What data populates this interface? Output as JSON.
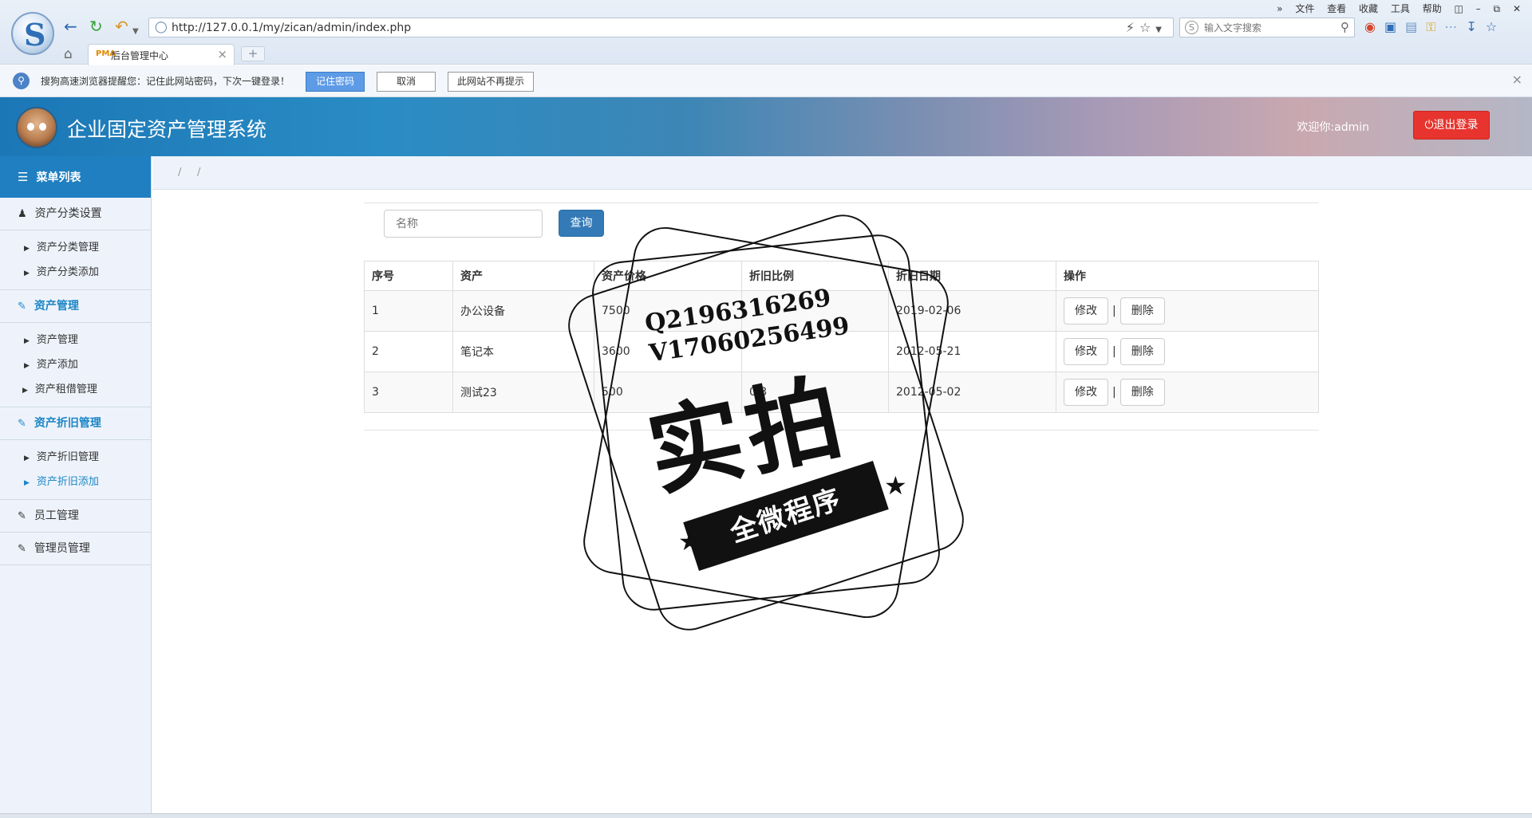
{
  "browser": {
    "url": "http://127.0.0.1/my/zican/admin/index.php",
    "tab_title": "后台管理中心",
    "tab_badge": "PMA",
    "search_placeholder": "输入文字搜索",
    "menu": [
      "文件",
      "查看",
      "收藏",
      "工具",
      "帮助"
    ],
    "password_bar": {
      "message": "搜狗高速浏览器提醒您：记住此网站密码，下次一键登录！",
      "remember_label": "记住密码",
      "cancel_label": "取消",
      "never_label": "此网站不再提示"
    }
  },
  "header": {
    "title": "企业固定资产管理系统",
    "welcome": "欢迎你:admin",
    "logout_label": "退出登录"
  },
  "sidebar": {
    "title": "菜单列表",
    "groups": [
      {
        "label": "资产分类设置",
        "items": [
          "资产分类管理",
          "资产分类添加"
        ]
      },
      {
        "label": "资产管理",
        "items": [
          "资产管理",
          "资产添加",
          "资产租借管理"
        ]
      },
      {
        "label": "资产折旧管理",
        "items": [
          "资产折旧管理",
          "资产折旧添加"
        ]
      },
      {
        "label": "员工管理"
      },
      {
        "label": "管理员管理"
      }
    ]
  },
  "breadcrumb": {
    "sep1": "/",
    "sep2": "/"
  },
  "search": {
    "placeholder": "名称",
    "button_label": "查询"
  },
  "table": {
    "headers": [
      "序号",
      "资产",
      "资产价格",
      "折旧比例",
      "折旧日期",
      "操作"
    ],
    "rows": [
      {
        "id": "1",
        "asset": "办公设备",
        "price": "7500",
        "ratio": "",
        "date": "2019-02-06"
      },
      {
        "id": "2",
        "asset": "笔记本",
        "price": "3600",
        "ratio": "",
        "date": "2012-05-21"
      },
      {
        "id": "3",
        "asset": "测试23",
        "price": "500",
        "ratio": "0.3",
        "date": "2012-05-02"
      }
    ],
    "edit_label": "修改",
    "delete_label": "删除",
    "action_sep": "|"
  },
  "watermark": {
    "line1": "Q2196316269",
    "line2": "V17060256499",
    "big": "实拍",
    "ribbon": "全微程序"
  },
  "colors": {
    "accent": "#1f7fc0",
    "primary_button": "#337ab7",
    "logout": "#e8342e"
  }
}
